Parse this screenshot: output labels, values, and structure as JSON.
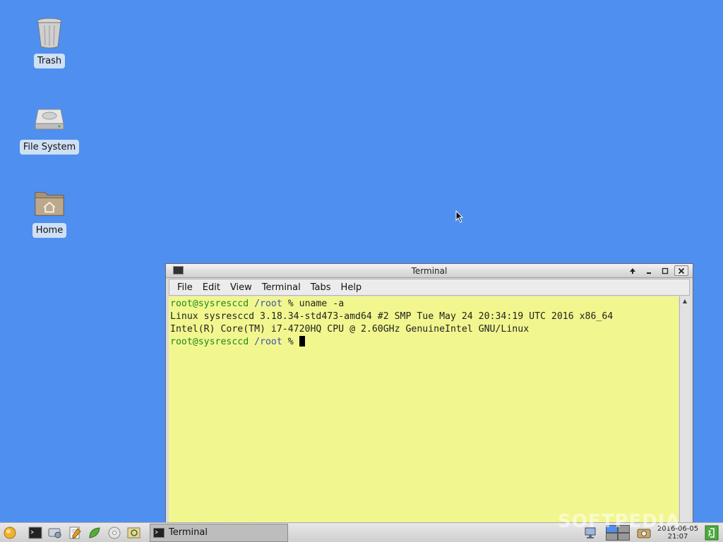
{
  "desktop": {
    "icons": [
      {
        "label": "Trash",
        "icon": "trash-icon"
      },
      {
        "label": "File System",
        "icon": "drive-icon"
      },
      {
        "label": "Home",
        "icon": "home-folder-icon"
      }
    ]
  },
  "window": {
    "title": "Terminal",
    "menu": [
      "File",
      "Edit",
      "View",
      "Terminal",
      "Tabs",
      "Help"
    ],
    "terminal": {
      "line1_host": "root@sysresccd",
      "line1_path": "/root",
      "line1_cmd": "% uname -a",
      "line2": "Linux sysresccd 3.18.34-std473-amd64 #2 SMP Tue May 24 20:34:19 UTC 2016 x86_64",
      "line3": "Intel(R) Core(TM) i7-4720HQ CPU @ 2.60GHz GenuineIntel GNU/Linux",
      "line4_host": "root@sysresccd",
      "line4_path": "/root",
      "line4_cmd": "% "
    }
  },
  "taskbar": {
    "task_label": "Terminal",
    "clock_date": "2016-06-05",
    "clock_time": "21:07",
    "launchers": [
      "menu-icon",
      "terminal-icon",
      "network-tool-icon",
      "text-editor-icon",
      "leaf-icon",
      "disc-icon",
      "browser-icon"
    ]
  },
  "watermark": "SOFTPEDIA"
}
